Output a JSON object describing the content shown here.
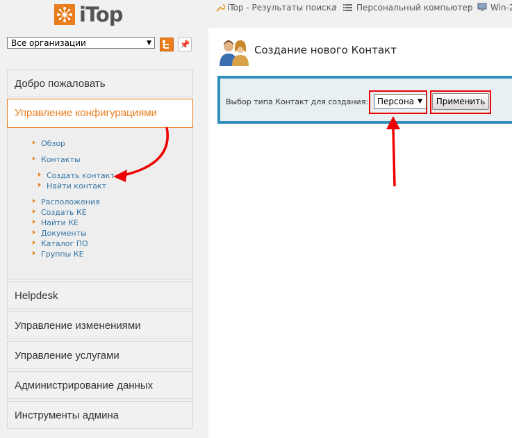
{
  "app": {
    "logo_text": "iTop"
  },
  "org_selector": {
    "value": "Все организации"
  },
  "sidebar": {
    "menus": [
      {
        "label": "Добро пожаловать"
      },
      {
        "label": "Управление конфигурациями"
      },
      {
        "label": "Helpdesk"
      },
      {
        "label": "Управление изменениями"
      },
      {
        "label": "Управление услугами"
      },
      {
        "label": "Администрирование данных"
      },
      {
        "label": "Инструменты админа"
      }
    ],
    "submenu": [
      "Обзор",
      "Контакты",
      "Создать контакт",
      "Найти контакт",
      "Расположения",
      "Создать КЕ",
      "Найти КЕ",
      "Документы",
      "Каталог ПО",
      "Группы КЕ"
    ]
  },
  "breadcrumb": {
    "items": [
      "iTop - Результаты поиска",
      "Персональный компьютер",
      "Win-2"
    ]
  },
  "page": {
    "title": "Создание нового Контакт",
    "create_label": "Выбор типа Контакт для создания:",
    "type_value": "Персона",
    "apply_label": "Применить"
  },
  "colors": {
    "accent": "#ea7d1e",
    "link": "#3375a6",
    "panel_border": "#2e8fb8",
    "annotation": "#e00000"
  },
  "icons": {
    "logo": "itop-logo-icon",
    "contact": "contacts-icon",
    "breadcrumb_tool": "wrench-icon",
    "breadcrumb_list": "list-icon",
    "breadcrumb_pc": "computer-icon"
  }
}
